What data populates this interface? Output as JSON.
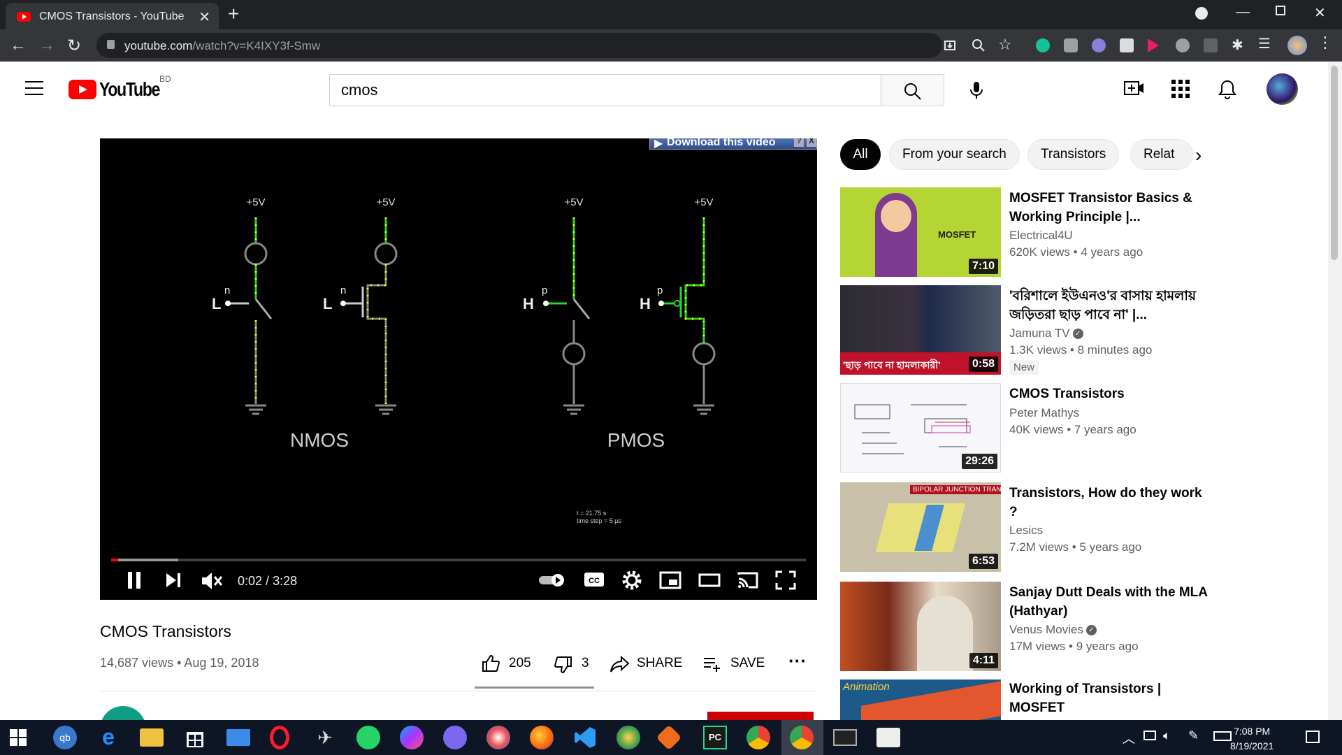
{
  "browser": {
    "tab_title": "CMOS Transistors - YouTube",
    "url_host": "youtube.com",
    "url_path": "/watch?v=K4IXY3f-Smw"
  },
  "header": {
    "logo_text": "YouTube",
    "country_code": "BD",
    "search_value": "cmos"
  },
  "player": {
    "download_banner": "Download this video",
    "time_current": "0:02",
    "time_total": "3:28",
    "progress": 0.01,
    "scene": {
      "nmos_label": "NMOS",
      "pmos_label": "PMOS",
      "supply": "+5V",
      "nmos_input": "L",
      "pmos_input": "H",
      "nmos_type": "n",
      "pmos_type": "p",
      "sim_time": "t = 21.75 s",
      "time_step": "time step = 5 µs"
    }
  },
  "video": {
    "title": "CMOS Transistors",
    "meta": "14,687 views • Aug 19, 2018",
    "likes": "205",
    "dislikes": "3",
    "share_label": "SHARE",
    "save_label": "SAVE"
  },
  "chips": [
    "All",
    "From your search",
    "Transistors",
    "Relat"
  ],
  "recommendations": [
    {
      "title": "MOSFET Transistor Basics & Working Principle |...",
      "channel": "Electrical4U",
      "verified": false,
      "views": "620K views • 4 years ago",
      "duration": "7:10",
      "badge": "",
      "thumb_text": "MOSFET"
    },
    {
      "title": "'বরিশালে ইউএনও'র বাসায় হামলায় জড়িতরা ছাড় পাবে না' |...",
      "channel": "Jamuna TV",
      "verified": true,
      "views": "1.3K views • 8 minutes ago",
      "duration": "0:58",
      "badge": "New",
      "thumb_text": "'ছাড় পাবে না হামলাকারী'"
    },
    {
      "title": "CMOS Transistors",
      "channel": "Peter Mathys",
      "verified": false,
      "views": "40K views • 7 years ago",
      "duration": "29:26",
      "badge": "",
      "thumb_text": ""
    },
    {
      "title": "Transistors, How do they work ?",
      "channel": "Lesics",
      "verified": false,
      "views": "7.2M views • 5 years ago",
      "duration": "6:53",
      "badge": "",
      "thumb_text": "BIPOLAR JUNCTION TRANSISTOR"
    },
    {
      "title": "Sanjay Dutt Deals with the MLA (Hathyar)",
      "channel": "Venus Movies",
      "verified": true,
      "views": "17M views • 9 years ago",
      "duration": "4:11",
      "badge": "",
      "thumb_text": ""
    },
    {
      "title": "Working of Transistors | MOSFET",
      "channel": "",
      "verified": false,
      "views": "",
      "duration": "",
      "badge": "",
      "thumb_text": "Animation"
    }
  ],
  "taskbar": {
    "time": "7:08 PM",
    "date": "8/19/2021"
  }
}
